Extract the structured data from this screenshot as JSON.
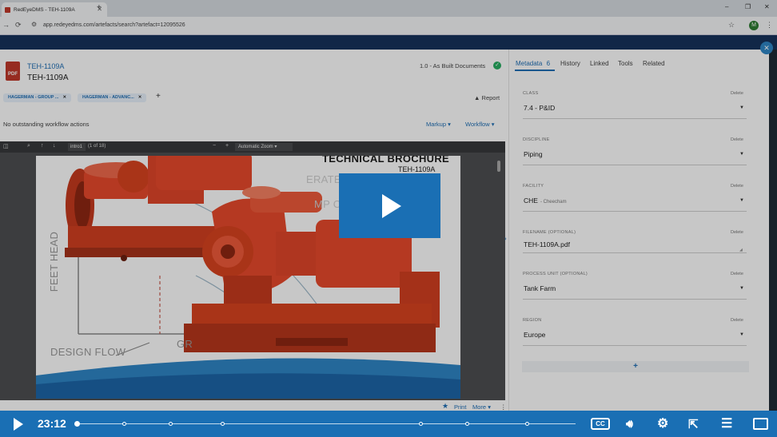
{
  "browser": {
    "tab_title": "RedEyeDMS - TEH-1109A",
    "new_tab": "+",
    "url": "app.redeyedms.com/artefacts/search?artefact=12095526",
    "profile_initial": "M",
    "minimize": "–",
    "restore": "❐",
    "close": "✕"
  },
  "document": {
    "link": "TEH-1109A",
    "title": "TEH-1109A",
    "revision": "1.0 - As Built Documents",
    "file_type": "PDF",
    "tags": [
      "HAGERMAN - GROUP ...",
      "HAGERMAN - ADVANC..."
    ],
    "add_tag": "+",
    "report": "Report",
    "workflow_message": "No outstanding workflow actions",
    "markup": "Markup",
    "workflow": "Workflow"
  },
  "viewer": {
    "page_input": "intro1",
    "page_count": "(1 of 18)",
    "zoom": "Automatic Zoom",
    "zoom_out": "−",
    "zoom_in": "+",
    "print": "Print",
    "more": "More",
    "page": {
      "title": "TECHNICAL BROCHURE",
      "code": "TEH-1109A",
      "y_label": "FEET HEAD",
      "x_label": "DESIGN FLOW",
      "partial_1": "ERATE",
      "partial_2": "MP CU",
      "partial_3": "GR"
    }
  },
  "metadata": {
    "tabs": [
      {
        "label": "Metadata",
        "count": "6"
      },
      {
        "label": "History"
      },
      {
        "label": "Linked"
      },
      {
        "label": "Tools"
      },
      {
        "label": "Related"
      }
    ],
    "delete_label": "Delete",
    "fields": [
      {
        "label": "CLASS",
        "value": "7.4 - P&ID",
        "sub": ""
      },
      {
        "label": "DISCIPLINE",
        "value": "Piping",
        "sub": ""
      },
      {
        "label": "FACILITY",
        "value": "CHE",
        "sub": "- Cheecham"
      },
      {
        "label": "FILENAME (OPTIONAL)",
        "value": "TEH-1109A.pdf",
        "sub": ""
      },
      {
        "label": "PROCESS UNIT (OPTIONAL)",
        "value": "Tank Farm",
        "sub": ""
      },
      {
        "label": "REGION",
        "value": "Europe",
        "sub": ""
      }
    ],
    "add": "+"
  },
  "video": {
    "current_time": "23:12",
    "progress": 0.0,
    "captions": "CC"
  },
  "colors": {
    "accent": "#1a6fb4",
    "link": "#1f6fb5",
    "navy": "#16325c",
    "pump": "#e8492c",
    "ok": "#27ae60"
  }
}
